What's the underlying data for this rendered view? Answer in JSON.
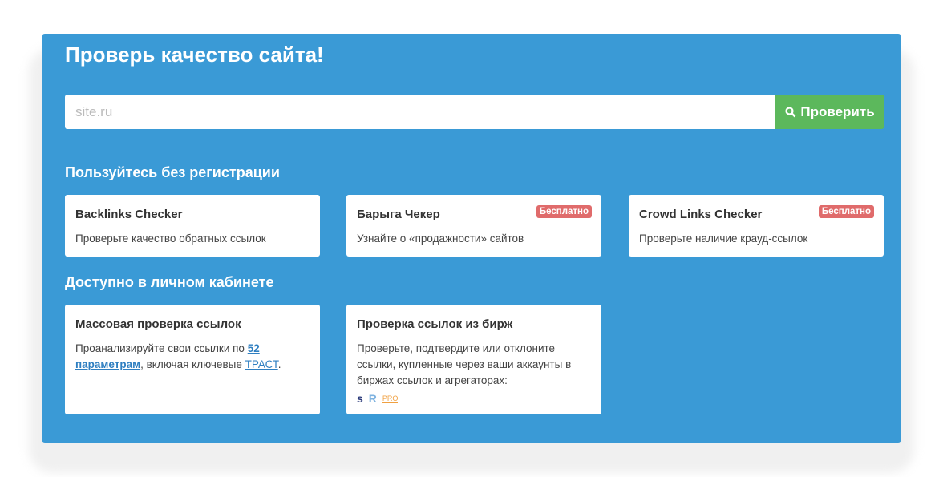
{
  "title": "Проверь качество сайта!",
  "search": {
    "placeholder": "site.ru",
    "button": "Проверить"
  },
  "section1": "Пользуйтесь без регистрации",
  "section2": "Доступно в личном кабинете",
  "free_cards": [
    {
      "title": "Backlinks Checker",
      "desc": "Проверьте качество обратных ссылок"
    },
    {
      "title": "Барыга Чекер",
      "desc": "Узнайте о «продажности» сайтов",
      "badge": "Бесплатно"
    },
    {
      "title": "Crowd Links Checker",
      "desc": "Проверьте наличие крауд-ссылок",
      "badge": "Бесплатно"
    }
  ],
  "paid_cards": [
    {
      "title": "Массовая проверка ссылок",
      "desc_pre": "Проанализируйте свои ссылки по ",
      "link1": "52 параметрам",
      "desc_mid": ", включая ключевые ",
      "link2": "ТРАСТ",
      "desc_post": "."
    },
    {
      "title": "Проверка ссылок из бирж",
      "desc": "Проверьте, подтвердите или отклоните ссылки, купленные через ваши аккаунты в биржах ссылок и агрегаторах:",
      "icons": {
        "s": "s",
        "r": "R",
        "pro": "PRO"
      }
    }
  ]
}
